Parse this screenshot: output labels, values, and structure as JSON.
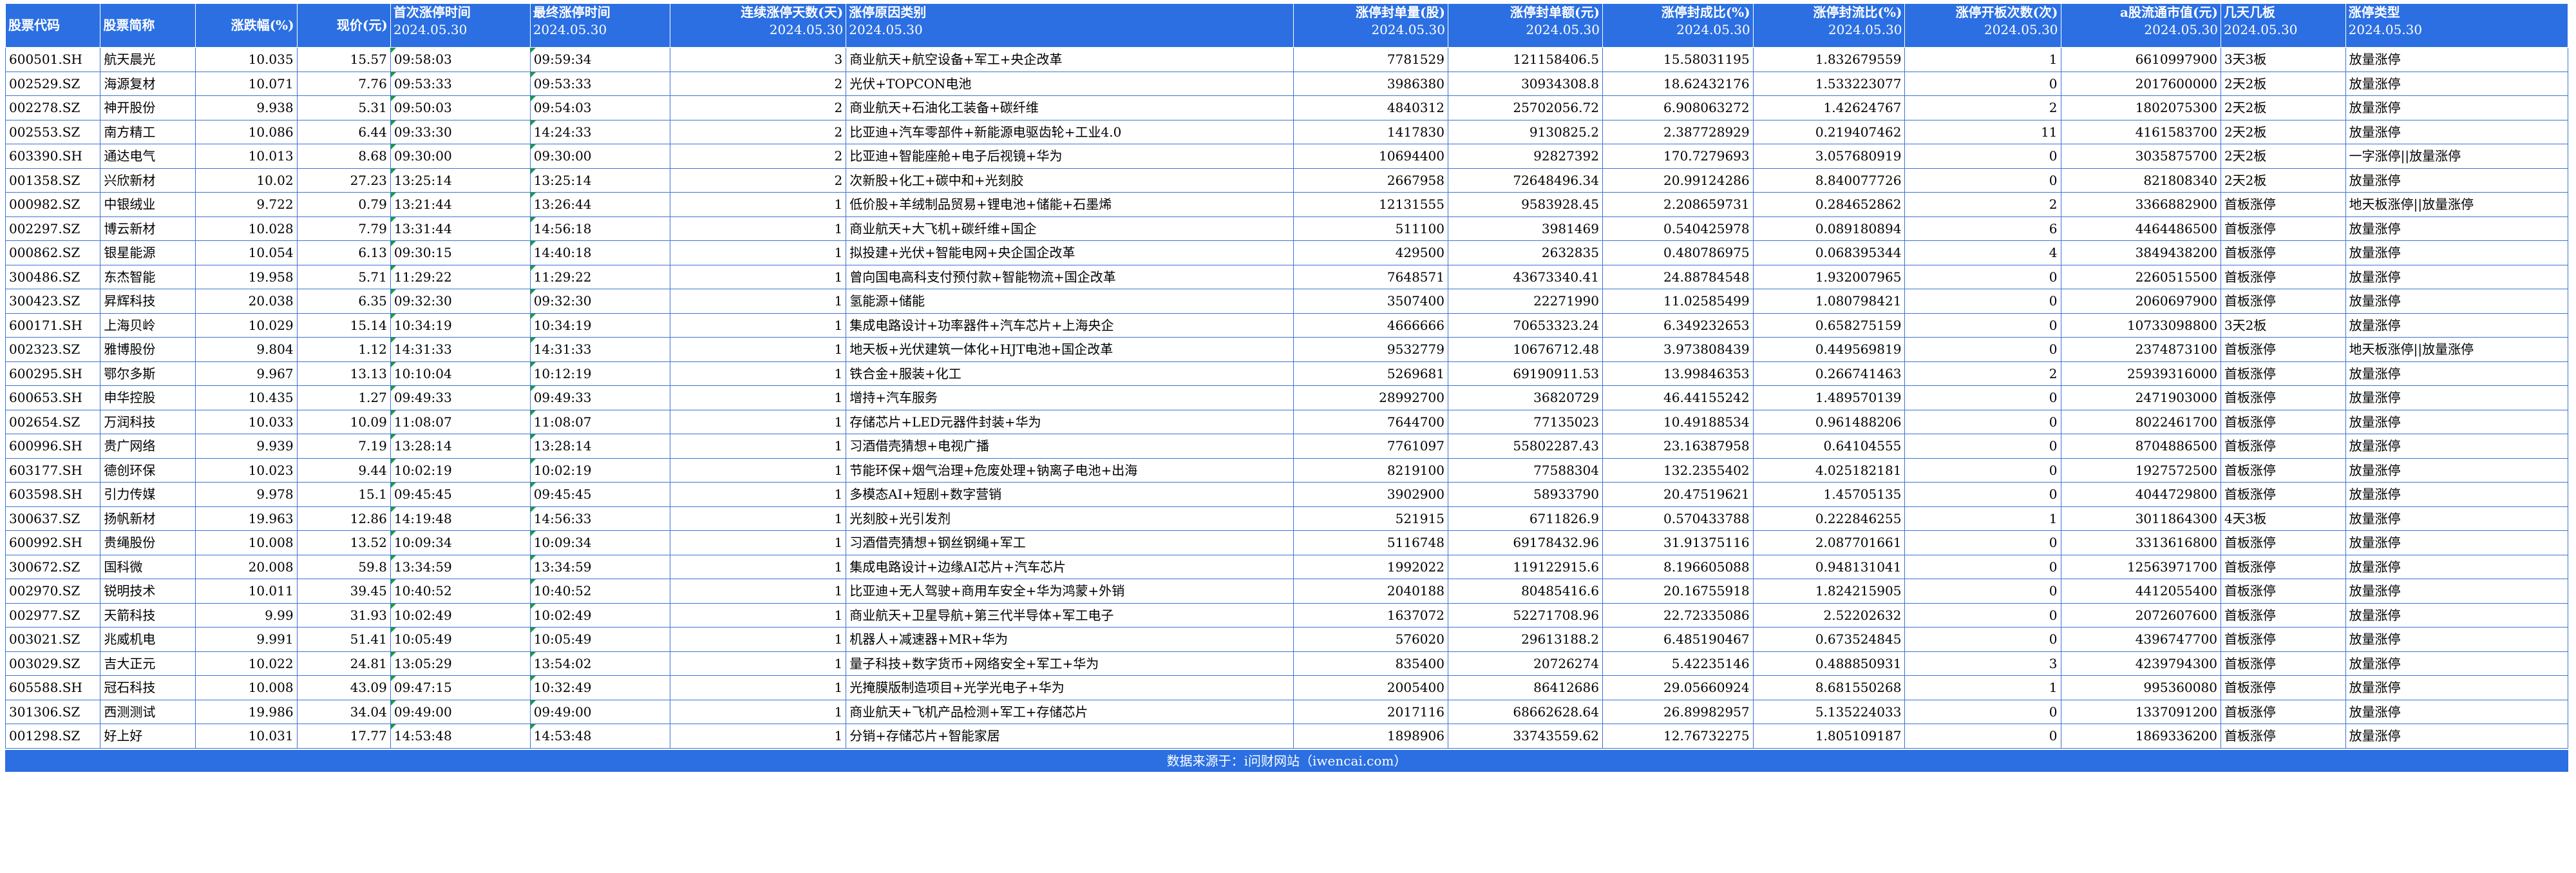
{
  "columns": [
    {
      "key": "code",
      "line1": "股票代码",
      "line2": "",
      "align": "left",
      "single": true
    },
    {
      "key": "name",
      "line1": "股票简称",
      "line2": "",
      "align": "left",
      "single": true
    },
    {
      "key": "chg",
      "line1": "涨跌幅(%)",
      "line2": "",
      "align": "right",
      "single": true
    },
    {
      "key": "price",
      "line1": "现价(元)",
      "line2": "",
      "align": "right",
      "single": true
    },
    {
      "key": "first_time",
      "line1": "首次涨停时间",
      "line2": "2024.05.30",
      "align": "left",
      "single": false
    },
    {
      "key": "last_time",
      "line1": "最终涨停时间",
      "line2": "2024.05.30",
      "align": "left",
      "single": false
    },
    {
      "key": "days",
      "line1": "连续涨停天数(天)",
      "line2": "2024.05.30",
      "align": "right",
      "single": false
    },
    {
      "key": "reason",
      "line1": "涨停原因类别",
      "line2": "2024.05.30",
      "align": "left",
      "single": false
    },
    {
      "key": "seal_vol",
      "line1": "涨停封单量(股)",
      "line2": "2024.05.30",
      "align": "right",
      "single": false
    },
    {
      "key": "seal_amt",
      "line1": "涨停封单额(元)",
      "line2": "2024.05.30",
      "align": "right",
      "single": false
    },
    {
      "key": "seal_ratio",
      "line1": "涨停封成比(%)",
      "line2": "2024.05.30",
      "align": "right",
      "single": false
    },
    {
      "key": "seal_flow",
      "line1": "涨停封流比(%)",
      "line2": "2024.05.30",
      "align": "right",
      "single": false
    },
    {
      "key": "open_cnt",
      "line1": "涨停开板次数(次)",
      "line2": "2024.05.30",
      "align": "right",
      "single": false
    },
    {
      "key": "float_cap",
      "line1": "a股流通市值(元)",
      "line2": "2024.05.30",
      "align": "right",
      "single": false
    },
    {
      "key": "board",
      "line1": "几天几板",
      "line2": "2024.05.30",
      "align": "left",
      "single": false
    },
    {
      "key": "type",
      "line1": "涨停类型",
      "line2": "2024.05.30",
      "align": "left",
      "single": false
    }
  ],
  "rows": [
    [
      "600501.SH",
      "航天晨光",
      "10.035",
      "15.57",
      "09:58:03",
      "09:59:34",
      "3",
      "商业航天+航空设备+军工+央企改革",
      "7781529",
      "121158406.5",
      "15.58031195",
      "1.832679559",
      "1",
      "6610997900",
      "3天3板",
      "放量涨停"
    ],
    [
      "002529.SZ",
      "海源复材",
      "10.071",
      "7.76",
      "09:53:33",
      "09:53:33",
      "2",
      "光伏+TOPCON电池",
      "3986380",
      "30934308.8",
      "18.62432176",
      "1.533223077",
      "0",
      "2017600000",
      "2天2板",
      "放量涨停"
    ],
    [
      "002278.SZ",
      "神开股份",
      "9.938",
      "5.31",
      "09:50:03",
      "09:54:03",
      "2",
      "商业航天+石油化工装备+碳纤维",
      "4840312",
      "25702056.72",
      "6.908063272",
      "1.42624767",
      "2",
      "1802075300",
      "2天2板",
      "放量涨停"
    ],
    [
      "002553.SZ",
      "南方精工",
      "10.086",
      "6.44",
      "09:33:30",
      "14:24:33",
      "2",
      "比亚迪+汽车零部件+新能源电驱齿轮+工业4.0",
      "1417830",
      "9130825.2",
      "2.387728929",
      "0.219407462",
      "11",
      "4161583700",
      "2天2板",
      "放量涨停"
    ],
    [
      "603390.SH",
      "通达电气",
      "10.013",
      "8.68",
      "09:30:00",
      "09:30:00",
      "2",
      "比亚迪+智能座舱+电子后视镜+华为",
      "10694400",
      "92827392",
      "170.7279693",
      "3.057680919",
      "0",
      "3035875700",
      "2天2板",
      "一字涨停||放量涨停"
    ],
    [
      "001358.SZ",
      "兴欣新材",
      "10.02",
      "27.23",
      "13:25:14",
      "13:25:14",
      "2",
      "次新股+化工+碳中和+光刻胶",
      "2667958",
      "72648496.34",
      "20.99124286",
      "8.840077726",
      "0",
      "821808340",
      "2天2板",
      "放量涨停"
    ],
    [
      "000982.SZ",
      "中银绒业",
      "9.722",
      "0.79",
      "13:21:44",
      "13:26:44",
      "1",
      "低价股+羊绒制品贸易+锂电池+储能+石墨烯",
      "12131555",
      "9583928.45",
      "2.208659731",
      "0.284652862",
      "2",
      "3366882900",
      "首板涨停",
      "地天板涨停||放量涨停"
    ],
    [
      "002297.SZ",
      "博云新材",
      "10.028",
      "7.79",
      "13:31:44",
      "14:56:18",
      "1",
      "商业航天+大飞机+碳纤维+国企",
      "511100",
      "3981469",
      "0.540425978",
      "0.089180894",
      "6",
      "4464486500",
      "首板涨停",
      "放量涨停"
    ],
    [
      "000862.SZ",
      "银星能源",
      "10.054",
      "6.13",
      "09:30:15",
      "14:40:18",
      "1",
      "拟投建+光伏+智能电网+央企国企改革",
      "429500",
      "2632835",
      "0.480786975",
      "0.068395344",
      "4",
      "3849438200",
      "首板涨停",
      "放量涨停"
    ],
    [
      "300486.SZ",
      "东杰智能",
      "19.958",
      "5.71",
      "11:29:22",
      "11:29:22",
      "1",
      "曾向国电高科支付预付款+智能物流+国企改革",
      "7648571",
      "43673340.41",
      "24.88784548",
      "1.932007965",
      "0",
      "2260515500",
      "首板涨停",
      "放量涨停"
    ],
    [
      "300423.SZ",
      "昇辉科技",
      "20.038",
      "6.35",
      "09:32:30",
      "09:32:30",
      "1",
      "氢能源+储能",
      "3507400",
      "22271990",
      "11.02585499",
      "1.080798421",
      "0",
      "2060697900",
      "首板涨停",
      "放量涨停"
    ],
    [
      "600171.SH",
      "上海贝岭",
      "10.029",
      "15.14",
      "10:34:19",
      "10:34:19",
      "1",
      "集成电路设计+功率器件+汽车芯片+上海央企",
      "4666666",
      "70653323.24",
      "6.349232653",
      "0.658275159",
      "0",
      "10733098800",
      "3天2板",
      "放量涨停"
    ],
    [
      "002323.SZ",
      "雅博股份",
      "9.804",
      "1.12",
      "14:31:33",
      "14:31:33",
      "1",
      "地天板+光伏建筑一体化+HJT电池+国企改革",
      "9532779",
      "10676712.48",
      "3.973808439",
      "0.449569819",
      "0",
      "2374873100",
      "首板涨停",
      "地天板涨停||放量涨停"
    ],
    [
      "600295.SH",
      "鄂尔多斯",
      "9.967",
      "13.13",
      "10:10:04",
      "10:12:19",
      "1",
      "铁合金+服装+化工",
      "5269681",
      "69190911.53",
      "13.99846353",
      "0.266741463",
      "2",
      "25939316000",
      "首板涨停",
      "放量涨停"
    ],
    [
      "600653.SH",
      "申华控股",
      "10.435",
      "1.27",
      "09:49:33",
      "09:49:33",
      "1",
      "增持+汽车服务",
      "28992700",
      "36820729",
      "46.44155242",
      "1.489570139",
      "0",
      "2471903000",
      "首板涨停",
      "放量涨停"
    ],
    [
      "002654.SZ",
      "万润科技",
      "10.033",
      "10.09",
      "11:08:07",
      "11:08:07",
      "1",
      "存储芯片+LED元器件封装+华为",
      "7644700",
      "77135023",
      "10.49188534",
      "0.961488206",
      "0",
      "8022461700",
      "首板涨停",
      "放量涨停"
    ],
    [
      "600996.SH",
      "贵广网络",
      "9.939",
      "7.19",
      "13:28:14",
      "13:28:14",
      "1",
      "习酒借壳猜想+电视广播",
      "7761097",
      "55802287.43",
      "23.16387958",
      "0.64104555",
      "0",
      "8704886500",
      "首板涨停",
      "放量涨停"
    ],
    [
      "603177.SH",
      "德创环保",
      "10.023",
      "9.44",
      "10:02:19",
      "10:02:19",
      "1",
      "节能环保+烟气治理+危废处理+钠离子电池+出海",
      "8219100",
      "77588304",
      "132.2355402",
      "4.025182181",
      "0",
      "1927572500",
      "首板涨停",
      "放量涨停"
    ],
    [
      "603598.SH",
      "引力传媒",
      "9.978",
      "15.1",
      "09:45:45",
      "09:45:45",
      "1",
      "多模态AI+短剧+数字营销",
      "3902900",
      "58933790",
      "20.47519621",
      "1.45705135",
      "0",
      "4044729800",
      "首板涨停",
      "放量涨停"
    ],
    [
      "300637.SZ",
      "扬帆新材",
      "19.963",
      "12.86",
      "14:19:48",
      "14:56:33",
      "1",
      "光刻胶+光引发剂",
      "521915",
      "6711826.9",
      "0.570433788",
      "0.222846255",
      "1",
      "3011864300",
      "4天3板",
      "放量涨停"
    ],
    [
      "600992.SH",
      "贵绳股份",
      "10.008",
      "13.52",
      "10:09:34",
      "10:09:34",
      "1",
      "习酒借壳猜想+钢丝钢绳+军工",
      "5116748",
      "69178432.96",
      "31.91375116",
      "2.087701661",
      "0",
      "3313616800",
      "首板涨停",
      "放量涨停"
    ],
    [
      "300672.SZ",
      "国科微",
      "20.008",
      "59.8",
      "13:34:59",
      "13:34:59",
      "1",
      "集成电路设计+边缘AI芯片+汽车芯片",
      "1992022",
      "119122915.6",
      "8.196605088",
      "0.948131041",
      "0",
      "12563971700",
      "首板涨停",
      "放量涨停"
    ],
    [
      "002970.SZ",
      "锐明技术",
      "10.011",
      "39.45",
      "10:40:52",
      "10:40:52",
      "1",
      "比亚迪+无人驾驶+商用车安全+华为鸿蒙+外销",
      "2040188",
      "80485416.6",
      "20.16755918",
      "1.824215905",
      "0",
      "4412055400",
      "首板涨停",
      "放量涨停"
    ],
    [
      "002977.SZ",
      "天箭科技",
      "9.99",
      "31.93",
      "10:02:49",
      "10:02:49",
      "1",
      "商业航天+卫星导航+第三代半导体+军工电子",
      "1637072",
      "52271708.96",
      "22.72335086",
      "2.52202632",
      "0",
      "2072607600",
      "首板涨停",
      "放量涨停"
    ],
    [
      "003021.SZ",
      "兆威机电",
      "9.991",
      "51.41",
      "10:05:49",
      "10:05:49",
      "1",
      "机器人+减速器+MR+华为",
      "576020",
      "29613188.2",
      "6.485190467",
      "0.673524845",
      "0",
      "4396747700",
      "首板涨停",
      "放量涨停"
    ],
    [
      "003029.SZ",
      "吉大正元",
      "10.022",
      "24.81",
      "13:05:29",
      "13:54:02",
      "1",
      "量子科技+数字货币+网络安全+军工+华为",
      "835400",
      "20726274",
      "5.42235146",
      "0.488850931",
      "3",
      "4239794300",
      "首板涨停",
      "放量涨停"
    ],
    [
      "605588.SH",
      "冠石科技",
      "10.008",
      "43.09",
      "09:47:15",
      "10:32:49",
      "1",
      "光掩膜版制造项目+光学光电子+华为",
      "2005400",
      "86412686",
      "29.05660924",
      "8.681550268",
      "1",
      "995360080",
      "首板涨停",
      "放量涨停"
    ],
    [
      "301306.SZ",
      "西测测试",
      "19.986",
      "34.04",
      "09:49:00",
      "09:49:00",
      "1",
      "商业航天+飞机产品检测+军工+存储芯片",
      "2017116",
      "68662628.64",
      "26.89982957",
      "5.135224033",
      "0",
      "1337091200",
      "首板涨停",
      "放量涨停"
    ],
    [
      "001298.SZ",
      "好上好",
      "10.031",
      "17.77",
      "14:53:48",
      "14:53:48",
      "1",
      "分销+存储芯片+智能家居",
      "1898906",
      "33743559.62",
      "12.76732275",
      "1.805109187",
      "0",
      "1869336200",
      "首板涨停",
      "放量涨停"
    ]
  ],
  "footer": "数据来源于：i问财网站（iwencai.com）",
  "colors": {
    "header_bg": "#2b6fe2",
    "border": "#3b74d6",
    "tick": "#1a9c3a"
  }
}
